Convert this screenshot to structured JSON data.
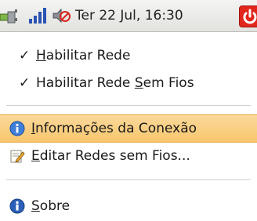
{
  "panel": {
    "clock": "Ter 22 Jul, 16:30",
    "icons": [
      "network-wired-icon",
      "wireless-signal-icon",
      "volume-muted-icon",
      "power-icon"
    ],
    "power_color": "#e2261c"
  },
  "menu": {
    "items": [
      {
        "checked": true,
        "label_pre": "",
        "label_mnemonic": "H",
        "label_post": "abilitar Rede"
      },
      {
        "checked": true,
        "label_pre": "Habilitar Rede ",
        "label_mnemonic": "S",
        "label_post": "em Fios"
      },
      {
        "icon": "info-icon",
        "label_pre": "",
        "label_mnemonic": "I",
        "label_post": "nformações da Conexão",
        "highlighted": true
      },
      {
        "icon": "edit-icon",
        "label_pre": "",
        "label_mnemonic": "E",
        "label_post": "ditar Redes sem Fios..."
      },
      {
        "icon": "about-icon",
        "label_pre": "",
        "label_mnemonic": "S",
        "label_post": "obre"
      }
    ],
    "check_glyph": "✓",
    "highlight_color": "#f7c66d"
  }
}
